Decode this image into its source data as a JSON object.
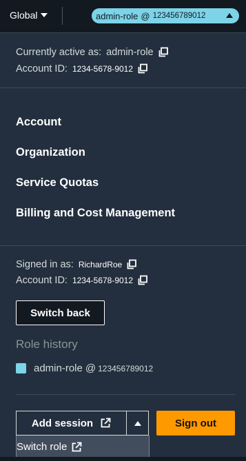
{
  "topbar": {
    "region_label": "Global",
    "role_pill": {
      "role_name": "admin-role",
      "at": "@",
      "account": "123456789012",
      "color": "#7dd3e8"
    }
  },
  "active_session": {
    "active_label": "Currently active as:",
    "active_value": "admin-role",
    "account_label": "Account ID:",
    "account_value": "1234-5678-9012"
  },
  "menu": {
    "items": [
      {
        "label": "Account"
      },
      {
        "label": "Organization"
      },
      {
        "label": "Service Quotas"
      },
      {
        "label": "Billing and Cost Management"
      }
    ]
  },
  "signed_in": {
    "signed_label": "Signed in as:",
    "signed_value": "RichardRoe",
    "account_label": "Account ID:",
    "account_value": "1234-5678-9012"
  },
  "switch_back_label": "Switch back",
  "role_history": {
    "title": "Role history",
    "entries": [
      {
        "role": "admin-role",
        "at": "@",
        "account": "123456789012",
        "color": "#7dd3e8"
      }
    ]
  },
  "actions": {
    "add_session_label": "Add session",
    "sign_out_label": "Sign out",
    "sign_out_color": "#ff9900"
  },
  "dropdown": {
    "switch_role_label": "Switch role"
  },
  "icons": {
    "region_caret": "caret-down-icon",
    "pill_caret": "caret-up-icon",
    "copy": "copy-icon",
    "external": "external-link-icon"
  }
}
